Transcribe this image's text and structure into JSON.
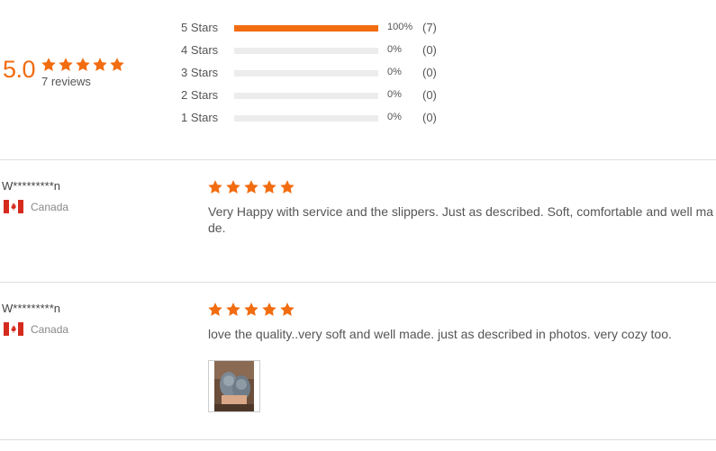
{
  "summary": {
    "average": "5.0",
    "review_count_label": "7 reviews",
    "accent_color": "#f26c10",
    "distribution": [
      {
        "label": "5 Stars",
        "percent_label": "100%",
        "count_label": "(7)",
        "fraction": 1.0
      },
      {
        "label": "4 Stars",
        "percent_label": "0%",
        "count_label": "(0)",
        "fraction": 0
      },
      {
        "label": "3 Stars",
        "percent_label": "0%",
        "count_label": "(0)",
        "fraction": 0
      },
      {
        "label": "2 Stars",
        "percent_label": "0%",
        "count_label": "(0)",
        "fraction": 0
      },
      {
        "label": "1 Stars",
        "percent_label": "0%",
        "count_label": "(0)",
        "fraction": 0
      }
    ]
  },
  "reviews": [
    {
      "name": "W*********n",
      "country": "Canada",
      "rating": 5,
      "text": "Very Happy with service and the slippers. Just as described. Soft, comfortable and well made.",
      "has_photo": false
    },
    {
      "name": "W*********n",
      "country": "Canada",
      "rating": 5,
      "text": "love the quality..very soft and well made. just as described in photos. very cozy too.",
      "has_photo": true
    }
  ]
}
